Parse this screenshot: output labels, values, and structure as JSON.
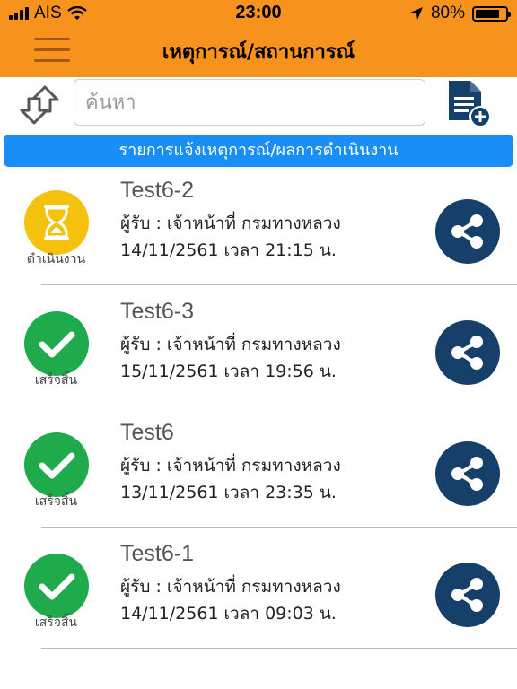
{
  "status_bar": {
    "carrier": "AIS",
    "time": "23:00",
    "battery": "80%",
    "battery_level": 0.8
  },
  "header": {
    "title": "เหตุการณ์/สถานการณ์",
    "menu_icon": "hamburger-icon",
    "color": "#f7921c"
  },
  "toolbar": {
    "sort_icon": "sort-arrows-icon",
    "search_placeholder": "ค้นหา",
    "search_value": "",
    "add_icon": "add-document-icon"
  },
  "banner": {
    "text": "รายการแจ้งเหตุการณ์/ผลการดำเนินงาน",
    "color": "#1a8ef7"
  },
  "items": [
    {
      "title": "Test6-2",
      "recipient": "ผู้รับ : เจ้าหน้าที่ กรมทางหลวง",
      "datetime": "14/11/2561 เวลา 21:15 น.",
      "status": "ดำเนินงาน",
      "status_icon": "hourglass-icon",
      "status_color": "#f4c20d"
    },
    {
      "title": "Test6-3",
      "recipient": "ผู้รับ : เจ้าหน้าที่ กรมทางหลวง",
      "datetime": "15/11/2561 เวลา 19:56 น.",
      "status": "เสร็จสิ้น",
      "status_icon": "check-icon",
      "status_color": "#1faa4b"
    },
    {
      "title": "Test6",
      "recipient": "ผู้รับ : เจ้าหน้าที่ กรมทางหลวง",
      "datetime": "13/11/2561 เวลา 23:35 น.",
      "status": "เสร็จสิ้น",
      "status_icon": "check-icon",
      "status_color": "#1faa4b"
    },
    {
      "title": "Test6-1",
      "recipient": "ผู้รับ : เจ้าหน้าที่ กรมทางหลวง",
      "datetime": "14/11/2561 เวลา 09:03 น.",
      "status": "เสร็จสิ้น",
      "status_icon": "check-icon",
      "status_color": "#1faa4b"
    }
  ],
  "share_color": "#16406a"
}
